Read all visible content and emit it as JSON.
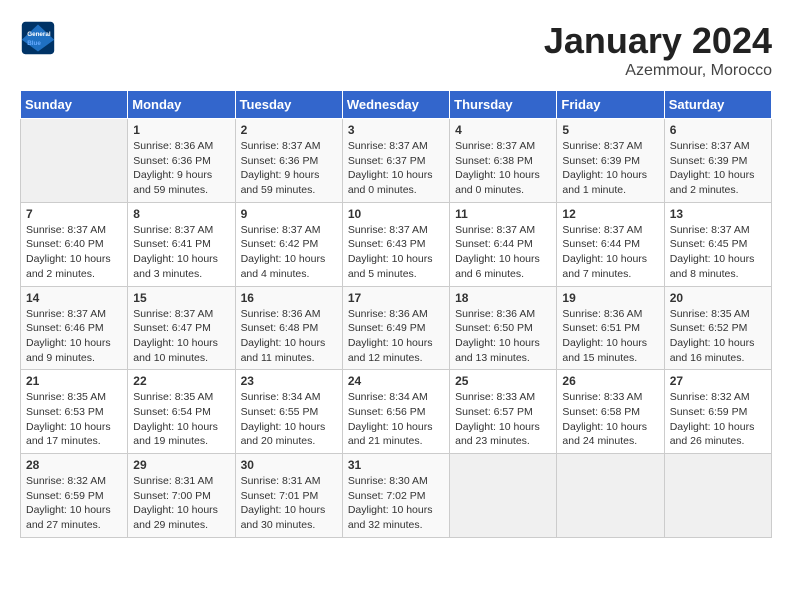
{
  "header": {
    "logo_line1": "General",
    "logo_line2": "Blue",
    "title": "January 2024",
    "subtitle": "Azemmour, Morocco"
  },
  "weekdays": [
    "Sunday",
    "Monday",
    "Tuesday",
    "Wednesday",
    "Thursday",
    "Friday",
    "Saturday"
  ],
  "weeks": [
    [
      {
        "day": "",
        "sunrise": "",
        "sunset": "",
        "daylight": ""
      },
      {
        "day": "1",
        "sunrise": "Sunrise: 8:36 AM",
        "sunset": "Sunset: 6:36 PM",
        "daylight": "Daylight: 9 hours and 59 minutes."
      },
      {
        "day": "2",
        "sunrise": "Sunrise: 8:37 AM",
        "sunset": "Sunset: 6:36 PM",
        "daylight": "Daylight: 9 hours and 59 minutes."
      },
      {
        "day": "3",
        "sunrise": "Sunrise: 8:37 AM",
        "sunset": "Sunset: 6:37 PM",
        "daylight": "Daylight: 10 hours and 0 minutes."
      },
      {
        "day": "4",
        "sunrise": "Sunrise: 8:37 AM",
        "sunset": "Sunset: 6:38 PM",
        "daylight": "Daylight: 10 hours and 0 minutes."
      },
      {
        "day": "5",
        "sunrise": "Sunrise: 8:37 AM",
        "sunset": "Sunset: 6:39 PM",
        "daylight": "Daylight: 10 hours and 1 minute."
      },
      {
        "day": "6",
        "sunrise": "Sunrise: 8:37 AM",
        "sunset": "Sunset: 6:39 PM",
        "daylight": "Daylight: 10 hours and 2 minutes."
      }
    ],
    [
      {
        "day": "7",
        "sunrise": "Sunrise: 8:37 AM",
        "sunset": "Sunset: 6:40 PM",
        "daylight": "Daylight: 10 hours and 2 minutes."
      },
      {
        "day": "8",
        "sunrise": "Sunrise: 8:37 AM",
        "sunset": "Sunset: 6:41 PM",
        "daylight": "Daylight: 10 hours and 3 minutes."
      },
      {
        "day": "9",
        "sunrise": "Sunrise: 8:37 AM",
        "sunset": "Sunset: 6:42 PM",
        "daylight": "Daylight: 10 hours and 4 minutes."
      },
      {
        "day": "10",
        "sunrise": "Sunrise: 8:37 AM",
        "sunset": "Sunset: 6:43 PM",
        "daylight": "Daylight: 10 hours and 5 minutes."
      },
      {
        "day": "11",
        "sunrise": "Sunrise: 8:37 AM",
        "sunset": "Sunset: 6:44 PM",
        "daylight": "Daylight: 10 hours and 6 minutes."
      },
      {
        "day": "12",
        "sunrise": "Sunrise: 8:37 AM",
        "sunset": "Sunset: 6:44 PM",
        "daylight": "Daylight: 10 hours and 7 minutes."
      },
      {
        "day": "13",
        "sunrise": "Sunrise: 8:37 AM",
        "sunset": "Sunset: 6:45 PM",
        "daylight": "Daylight: 10 hours and 8 minutes."
      }
    ],
    [
      {
        "day": "14",
        "sunrise": "Sunrise: 8:37 AM",
        "sunset": "Sunset: 6:46 PM",
        "daylight": "Daylight: 10 hours and 9 minutes."
      },
      {
        "day": "15",
        "sunrise": "Sunrise: 8:37 AM",
        "sunset": "Sunset: 6:47 PM",
        "daylight": "Daylight: 10 hours and 10 minutes."
      },
      {
        "day": "16",
        "sunrise": "Sunrise: 8:36 AM",
        "sunset": "Sunset: 6:48 PM",
        "daylight": "Daylight: 10 hours and 11 minutes."
      },
      {
        "day": "17",
        "sunrise": "Sunrise: 8:36 AM",
        "sunset": "Sunset: 6:49 PM",
        "daylight": "Daylight: 10 hours and 12 minutes."
      },
      {
        "day": "18",
        "sunrise": "Sunrise: 8:36 AM",
        "sunset": "Sunset: 6:50 PM",
        "daylight": "Daylight: 10 hours and 13 minutes."
      },
      {
        "day": "19",
        "sunrise": "Sunrise: 8:36 AM",
        "sunset": "Sunset: 6:51 PM",
        "daylight": "Daylight: 10 hours and 15 minutes."
      },
      {
        "day": "20",
        "sunrise": "Sunrise: 8:35 AM",
        "sunset": "Sunset: 6:52 PM",
        "daylight": "Daylight: 10 hours and 16 minutes."
      }
    ],
    [
      {
        "day": "21",
        "sunrise": "Sunrise: 8:35 AM",
        "sunset": "Sunset: 6:53 PM",
        "daylight": "Daylight: 10 hours and 17 minutes."
      },
      {
        "day": "22",
        "sunrise": "Sunrise: 8:35 AM",
        "sunset": "Sunset: 6:54 PM",
        "daylight": "Daylight: 10 hours and 19 minutes."
      },
      {
        "day": "23",
        "sunrise": "Sunrise: 8:34 AM",
        "sunset": "Sunset: 6:55 PM",
        "daylight": "Daylight: 10 hours and 20 minutes."
      },
      {
        "day": "24",
        "sunrise": "Sunrise: 8:34 AM",
        "sunset": "Sunset: 6:56 PM",
        "daylight": "Daylight: 10 hours and 21 minutes."
      },
      {
        "day": "25",
        "sunrise": "Sunrise: 8:33 AM",
        "sunset": "Sunset: 6:57 PM",
        "daylight": "Daylight: 10 hours and 23 minutes."
      },
      {
        "day": "26",
        "sunrise": "Sunrise: 8:33 AM",
        "sunset": "Sunset: 6:58 PM",
        "daylight": "Daylight: 10 hours and 24 minutes."
      },
      {
        "day": "27",
        "sunrise": "Sunrise: 8:32 AM",
        "sunset": "Sunset: 6:59 PM",
        "daylight": "Daylight: 10 hours and 26 minutes."
      }
    ],
    [
      {
        "day": "28",
        "sunrise": "Sunrise: 8:32 AM",
        "sunset": "Sunset: 6:59 PM",
        "daylight": "Daylight: 10 hours and 27 minutes."
      },
      {
        "day": "29",
        "sunrise": "Sunrise: 8:31 AM",
        "sunset": "Sunset: 7:00 PM",
        "daylight": "Daylight: 10 hours and 29 minutes."
      },
      {
        "day": "30",
        "sunrise": "Sunrise: 8:31 AM",
        "sunset": "Sunset: 7:01 PM",
        "daylight": "Daylight: 10 hours and 30 minutes."
      },
      {
        "day": "31",
        "sunrise": "Sunrise: 8:30 AM",
        "sunset": "Sunset: 7:02 PM",
        "daylight": "Daylight: 10 hours and 32 minutes."
      },
      {
        "day": "",
        "sunrise": "",
        "sunset": "",
        "daylight": ""
      },
      {
        "day": "",
        "sunrise": "",
        "sunset": "",
        "daylight": ""
      },
      {
        "day": "",
        "sunrise": "",
        "sunset": "",
        "daylight": ""
      }
    ]
  ]
}
